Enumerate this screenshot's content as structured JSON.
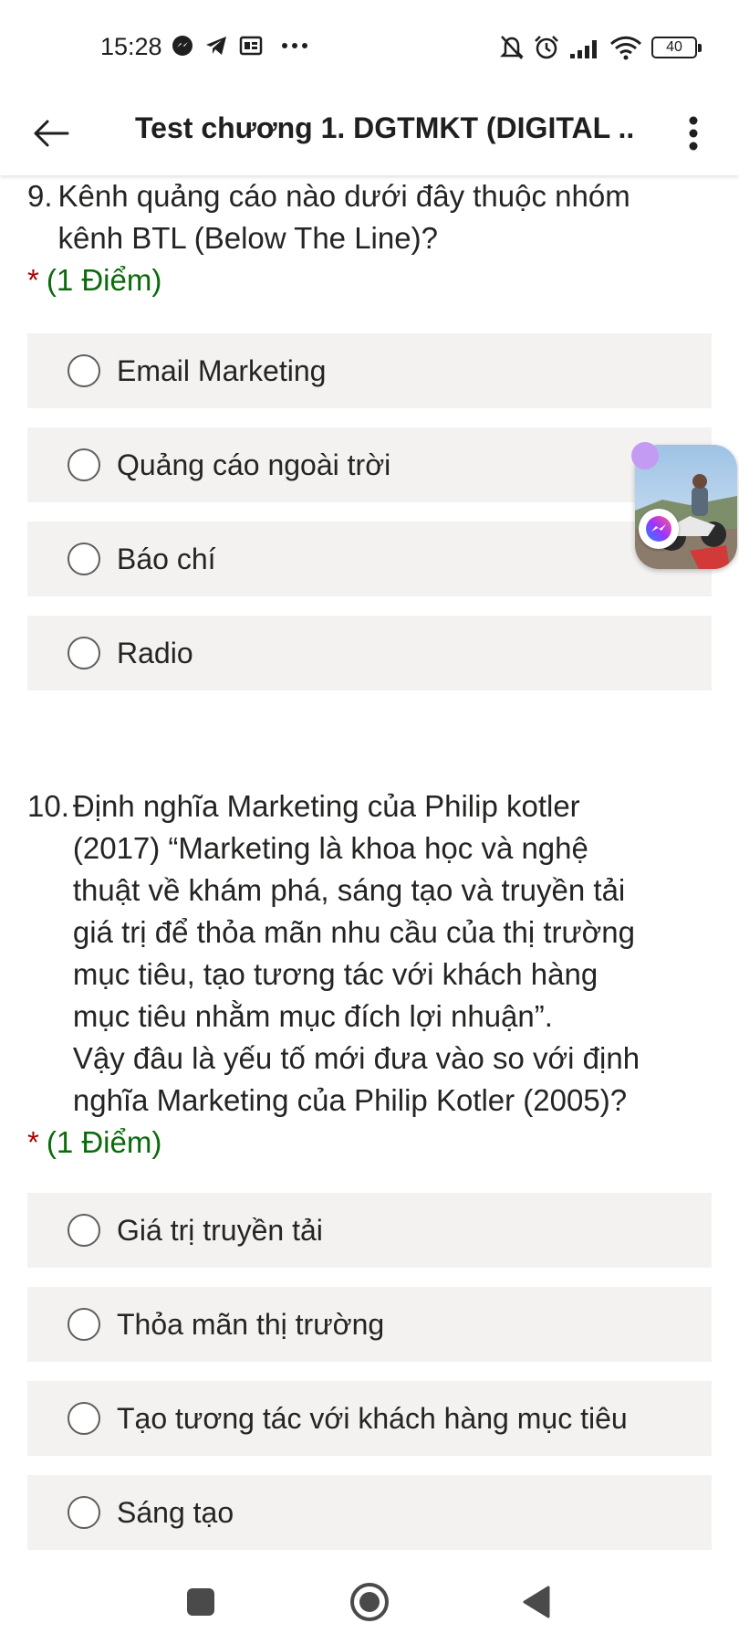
{
  "status_bar": {
    "time": "15:28",
    "left_icons": [
      "messenger-icon",
      "telegram-icon",
      "game-icon",
      "more-dots-icon"
    ],
    "right_icons": [
      "bell-off-icon",
      "alarm-icon",
      "signal-icon",
      "wifi-icon",
      "battery-icon"
    ],
    "battery": "40"
  },
  "header": {
    "title": "Test chương 1. DGTMKT (DIGITAL ..."
  },
  "questions": [
    {
      "number": "9.",
      "text": "Kênh quảng cáo nào dưới đây thuộc nhóm\nkênh BTL (Below The Line)?",
      "required_mark": "*",
      "points": "(1 Điểm)",
      "options": [
        "Email Marketing",
        "Quảng cáo ngoài trời",
        "Báo chí",
        "Radio"
      ]
    },
    {
      "number": "10.",
      "text": "Định nghĩa Marketing của Philip kotler\n(2017) “Marketing là khoa học và nghệ\nthuật về khám phá, sáng tạo và truyền tải\ngiá trị để thỏa mãn nhu cầu của thị trường\nmục tiêu, tạo tương tác với khách hàng\nmục tiêu nhằm mục đích lợi nhuận”.\nVậy đâu là yếu tố mới đưa vào so với định\nnghĩa Marketing của Philip Kotler (2005)?",
      "required_mark": "*",
      "points": "(1 Điểm)",
      "options": [
        "Giá trị truyền tải",
        "Thỏa mãn thị trường",
        "Tạo tương tác với khách hàng mục tiêu",
        "Sáng tạo"
      ]
    }
  ],
  "colors": {
    "option_bg": "#f3f2f1",
    "points_green": "#0b6a0b",
    "required_red": "#a80000",
    "text": "#252423"
  },
  "nav_bar": {
    "icons": [
      "recents-square-icon",
      "home-circle-icon",
      "back-triangle-icon"
    ]
  }
}
